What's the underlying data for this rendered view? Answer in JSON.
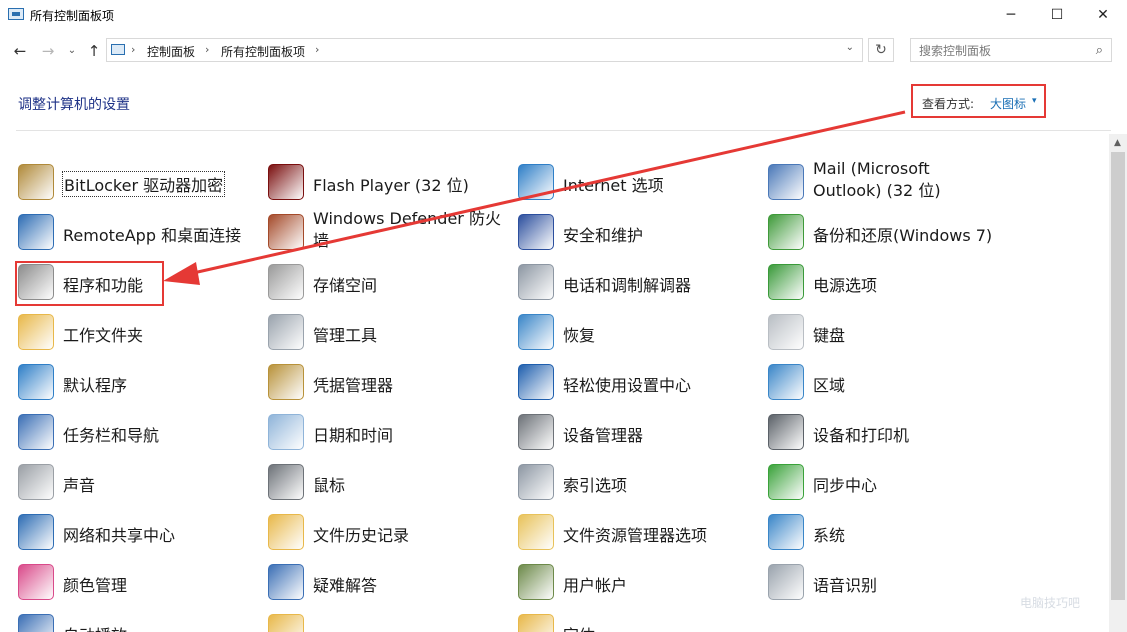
{
  "window": {
    "title": "所有控制面板项",
    "minimize_glyph": "─",
    "maximize_glyph": "☐",
    "close_glyph": "✕"
  },
  "nav": {
    "back_glyph": "←",
    "forward_glyph": "→",
    "dropdown_glyph": "⌄",
    "up_glyph": "↑",
    "breadcrumb": [
      "控制面板",
      "所有控制面板项"
    ],
    "breadcrumb_separator": "›",
    "address_dropdown_glyph": "⌄",
    "refresh_glyph": "↻"
  },
  "search": {
    "placeholder": "搜索控制面板",
    "icon_glyph": "⌕"
  },
  "heading": "调整计算机的设置",
  "view_by": {
    "label": "查看方式:",
    "value": "大图标",
    "caret": "▾"
  },
  "items": [
    [
      {
        "label": "BitLocker 驱动器加密",
        "icon": "bitlocker-icon",
        "color": "#b08a3a"
      },
      {
        "label": "Flash Player (32 位)",
        "icon": "flash-player-icon",
        "color": "#7a0f0f"
      },
      {
        "label": "Internet 选项",
        "icon": "internet-options-icon",
        "color": "#2f7fc7"
      },
      {
        "label": "Mail (Microsoft Outlook) (32 位)",
        "icon": "mail-icon",
        "color": "#4a78b8"
      }
    ],
    [
      {
        "label": "RemoteApp 和桌面连接",
        "icon": "remoteapp-icon",
        "color": "#2e6db4"
      },
      {
        "label": "Windows Defender 防火墙",
        "icon": "firewall-icon",
        "color": "#a44a2a"
      },
      {
        "label": "安全和维护",
        "icon": "security-flag-icon",
        "color": "#2c4f9e"
      },
      {
        "label": "备份和还原(Windows 7)",
        "icon": "backup-restore-icon",
        "color": "#3f9a3a"
      }
    ],
    [
      {
        "label": "程序和功能",
        "icon": "programs-features-icon",
        "color": "#8c8c8c"
      },
      {
        "label": "存储空间",
        "icon": "storage-spaces-icon",
        "color": "#9a9a9a"
      },
      {
        "label": "电话和调制解调器",
        "icon": "phone-modem-icon",
        "color": "#8d97a3"
      },
      {
        "label": "电源选项",
        "icon": "power-options-icon",
        "color": "#3a9a3a"
      }
    ],
    [
      {
        "label": "工作文件夹",
        "icon": "work-folders-icon",
        "color": "#e8b84a"
      },
      {
        "label": "管理工具",
        "icon": "admin-tools-icon",
        "color": "#9aa3ad"
      },
      {
        "label": "恢复",
        "icon": "recovery-icon",
        "color": "#3a86c8"
      },
      {
        "label": "键盘",
        "icon": "keyboard-icon",
        "color": "#b9bec4"
      }
    ],
    [
      {
        "label": "默认程序",
        "icon": "default-programs-icon",
        "color": "#2f7fc7"
      },
      {
        "label": "凭据管理器",
        "icon": "credential-manager-icon",
        "color": "#b8923a"
      },
      {
        "label": "轻松使用设置中心",
        "icon": "ease-of-access-icon",
        "color": "#1f5fae"
      },
      {
        "label": "区域",
        "icon": "region-icon",
        "color": "#3a86c8"
      }
    ],
    [
      {
        "label": "任务栏和导航",
        "icon": "taskbar-icon",
        "color": "#3b6fb5"
      },
      {
        "label": "日期和时间",
        "icon": "date-time-icon",
        "color": "#8fb4d9"
      },
      {
        "label": "设备管理器",
        "icon": "device-manager-icon",
        "color": "#6d7278"
      },
      {
        "label": "设备和打印机",
        "icon": "devices-printers-icon",
        "color": "#5b6168"
      }
    ],
    [
      {
        "label": "声音",
        "icon": "sound-icon",
        "color": "#9a9fa5"
      },
      {
        "label": "鼠标",
        "icon": "mouse-icon",
        "color": "#6d7278"
      },
      {
        "label": "索引选项",
        "icon": "indexing-options-icon",
        "color": "#8d97a3"
      },
      {
        "label": "同步中心",
        "icon": "sync-center-icon",
        "color": "#3aa23a"
      }
    ],
    [
      {
        "label": "网络和共享中心",
        "icon": "network-sharing-icon",
        "color": "#2e6db4"
      },
      {
        "label": "文件历史记录",
        "icon": "file-history-icon",
        "color": "#e8b84a"
      },
      {
        "label": "文件资源管理器选项",
        "icon": "explorer-options-icon",
        "color": "#e8c25a"
      },
      {
        "label": "系统",
        "icon": "system-icon",
        "color": "#3a86c8"
      }
    ],
    [
      {
        "label": "颜色管理",
        "icon": "color-management-icon",
        "color": "#d94a8a"
      },
      {
        "label": "疑难解答",
        "icon": "troubleshooting-icon",
        "color": "#3b6fb5"
      },
      {
        "label": "用户帐户",
        "icon": "user-accounts-icon",
        "color": "#6d8a4a"
      },
      {
        "label": "语音识别",
        "icon": "speech-recognition-icon",
        "color": "#9aa3ad"
      }
    ],
    [
      {
        "label": "自动播放",
        "icon": "autoplay-icon",
        "color": "#3b6fb5"
      },
      {
        "label": "",
        "icon": "generic-folder-icon",
        "color": "#e8b84a"
      },
      {
        "label": "字体",
        "icon": "fonts-icon",
        "color": "#e8b84a"
      },
      {
        "label": "",
        "icon": "generic-icon",
        "color": "#ffffff"
      }
    ]
  ],
  "watermark": "电脑技巧吧"
}
